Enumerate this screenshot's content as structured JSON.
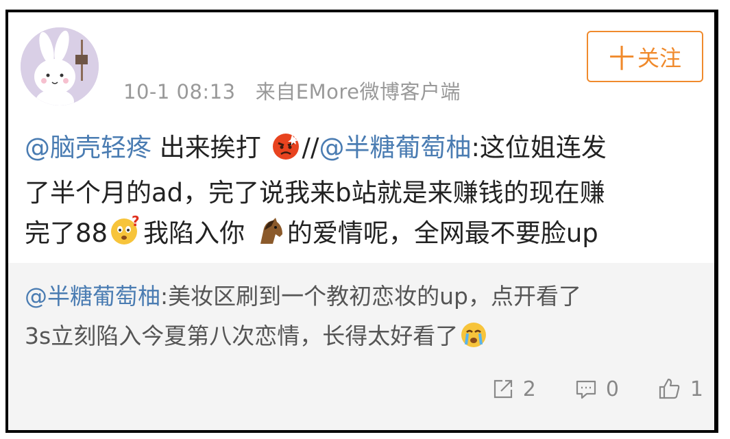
{
  "header": {
    "timestamp": "10-1 08:13",
    "source": "来自EMore微博客户端",
    "follow_label": "关注",
    "follow_plus": "十"
  },
  "post": {
    "mention1": "@脑壳轻疼",
    "text1": " 出来挨打",
    "slashes": "//",
    "mention2": "@半糖葡萄柚",
    "text2": ":这位姐连发",
    "line2": "了半个月的ad，完了说我来b站就是来赚钱的现在赚",
    "line3a": "完了88",
    "line3b": "我陷入你",
    "line3c": "的爱情呢，全网最不要脸up"
  },
  "repost": {
    "mention": "@半糖葡萄柚",
    "text1": ":美妆区刷到一个教初恋妆的up，点开看了",
    "line2": "3s立刻陷入今夏第八次恋情，长得太好看了"
  },
  "actions": {
    "share_count": "2",
    "comment_count": "0",
    "like_count": "1"
  },
  "colors": {
    "mention": "#4a7cb2",
    "follow": "#f08a2c",
    "repost_bg": "#f4f4f4"
  }
}
